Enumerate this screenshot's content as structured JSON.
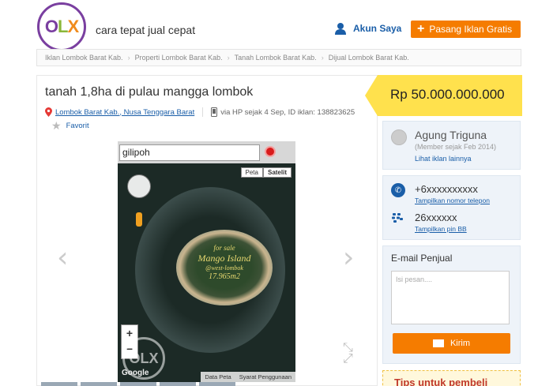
{
  "header": {
    "logo_text": "OLX",
    "tagline": "cara tepat jual cepat",
    "account_label": "Akun Saya",
    "post_ad_label": "Pasang Iklan Gratis"
  },
  "breadcrumb": [
    "Iklan Lombok Barat Kab.",
    "Properti Lombok Barat Kab.",
    "Tanah Lombok Barat Kab.",
    "Dijual Lombok Barat Kab."
  ],
  "ad": {
    "title": "tanah 1,8ha di pulau mangga lombok",
    "location": "Lombok Barat Kab., Nusa Tenggara Barat",
    "posted": "via HP sejak 4 Sep, ID iklan: 138823625",
    "favorite_label": "Favorit"
  },
  "gallery": {
    "search_text": "gilipoh",
    "map_type_map": "Peta",
    "map_type_satellite": "Satelit",
    "caption_line1": "for sale",
    "caption_line2": "Mango Island",
    "caption_line3": "@west-lombok",
    "caption_line4": "17.965m2",
    "zoom_in": "+",
    "zoom_out": "−",
    "watermark": "OLX",
    "google_label": "Google",
    "map_data_label": "Data Peta",
    "terms_label": "Syarat Penggunaan"
  },
  "price": "Rp 50.000.000.000",
  "seller": {
    "name": "Agung Triguna",
    "member_since": "(Member sejak Feb 2014)",
    "more_ads": "Lihat iklan lainnya"
  },
  "contact": {
    "phone": "+6xxxxxxxxxx",
    "show_phone": "Tampilkan nomor telepon",
    "pin": "26xxxxxx",
    "show_pin": "Tampilkan pin BB"
  },
  "email": {
    "title": "E-mail Penjual",
    "placeholder": "Isi pesan....",
    "send_label": "Kirim"
  },
  "tips_label": "Tips untuk pembeli",
  "colors": {
    "accent": "#f57c00",
    "link": "#1a5ea8",
    "price_bg": "#ffe14d"
  }
}
